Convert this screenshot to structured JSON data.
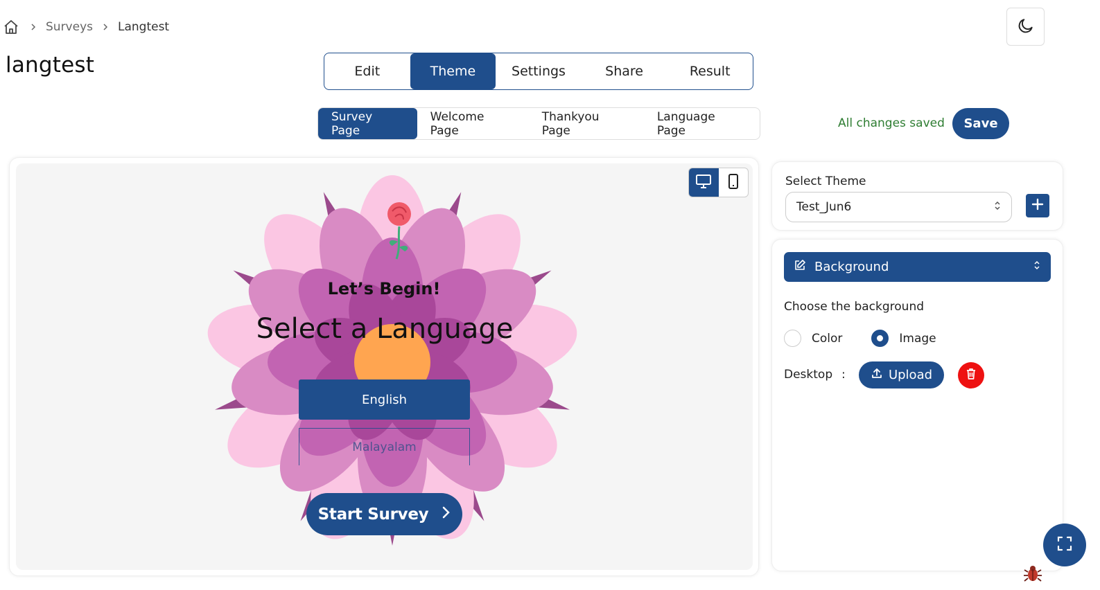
{
  "breadcrumb": {
    "items": [
      "Surveys",
      "Langtest"
    ]
  },
  "page": {
    "title": "langtest"
  },
  "main_tabs": [
    {
      "label": "Edit",
      "active": false
    },
    {
      "label": "Theme",
      "active": true
    },
    {
      "label": "Settings",
      "active": false
    },
    {
      "label": "Share",
      "active": false
    },
    {
      "label": "Result",
      "active": false
    }
  ],
  "sub_tabs": [
    {
      "label": "Survey Page",
      "active": true
    },
    {
      "label": "Welcome Page",
      "active": false
    },
    {
      "label": "Thankyou Page",
      "active": false
    },
    {
      "label": "Language Page",
      "active": false
    }
  ],
  "status": {
    "saved_text": "All changes saved",
    "save_label": "Save"
  },
  "preview": {
    "heading": "Let’s Begin!",
    "question": "Select a Language",
    "languages": [
      "English",
      "Malayalam"
    ],
    "start_label": "Start Survey",
    "device_active": "desktop"
  },
  "theme_panel": {
    "select_label": "Select Theme",
    "selected_theme": "Test_Jun6"
  },
  "background_panel": {
    "header": "Background",
    "choose_label": "Choose the background",
    "options": [
      {
        "label": "Color",
        "checked": false
      },
      {
        "label": "Image",
        "checked": true
      }
    ],
    "desktop_label": "Desktop",
    "colon": ":",
    "upload_label": "Upload"
  },
  "colors": {
    "primary": "#1f4e8c",
    "saved_green": "#2e7d32",
    "delete_red": "#ee1111"
  },
  "icons": {
    "home": "home-icon",
    "breadcrumb_sep": "chevron-right-icon",
    "theme_toggle": "moon-icon",
    "desktop": "monitor-icon",
    "mobile": "smartphone-icon",
    "edit": "edit-icon",
    "upload": "upload-icon",
    "delete": "trash-icon",
    "fullscreen": "fullscreen-icon",
    "bug": "bug-icon"
  }
}
